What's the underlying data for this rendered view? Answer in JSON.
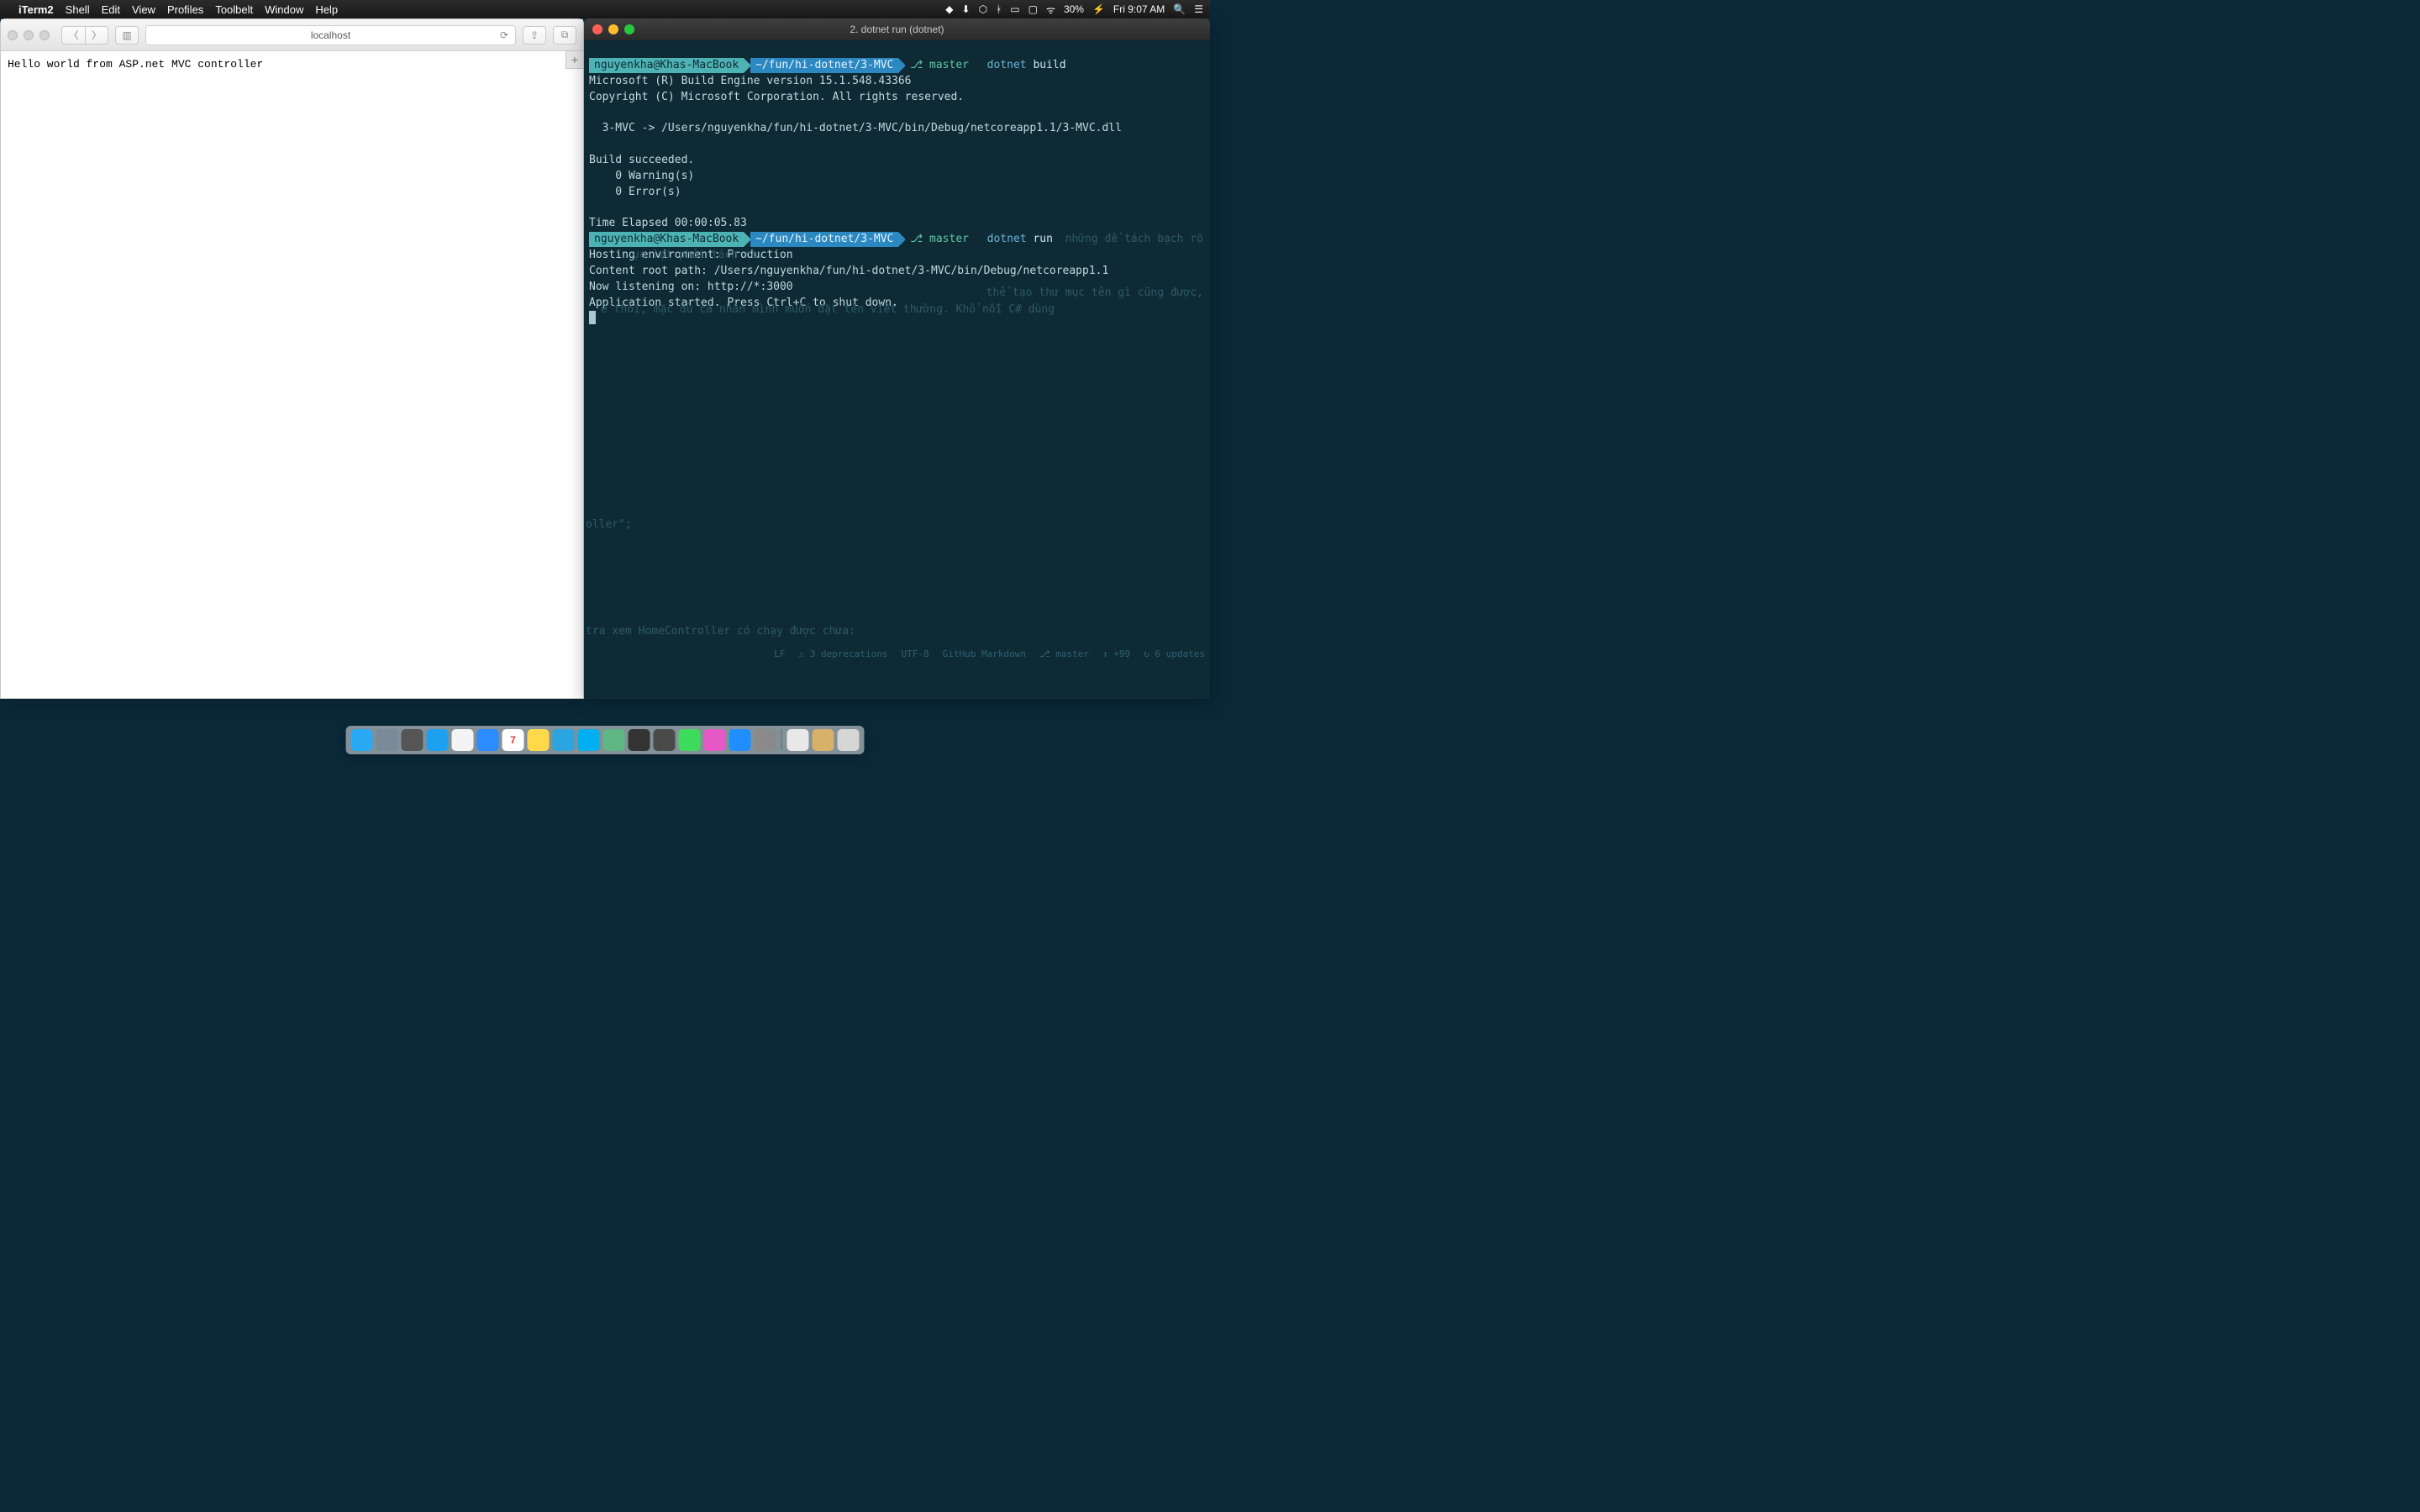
{
  "menubar": {
    "app": "iTerm2",
    "items": [
      "Shell",
      "Edit",
      "View",
      "Profiles",
      "Toolbelt",
      "Window",
      "Help"
    ],
    "battery": "30%",
    "clock": "Fri 9:07 AM"
  },
  "safari": {
    "address": "localhost",
    "body": "Hello world from ASP.net MVC controller"
  },
  "terminal": {
    "title": "2. dotnet run (dotnet)",
    "host": "nguyenkha@Khas-MacBook",
    "path": "~/fun/hi-dotnet/3-MVC",
    "branch": "master",
    "cmd1_kw": "dotnet",
    "cmd1_arg": "build",
    "out1_line1": "Microsoft (R) Build Engine version 15.1.548.43366",
    "out1_line2": "Copyright (C) Microsoft Corporation. All rights reserved.",
    "out1_line3": "  3-MVC -> /Users/nguyenkha/fun/hi-dotnet/3-MVC/bin/Debug/netcoreapp1.1/3-MVC.dll",
    "out1_line4": "Build succeeded.",
    "out1_line5": "    0 Warning(s)",
    "out1_line6": "    0 Error(s)",
    "out1_line7": "Time Elapsed 00:00:05.83",
    "cmd2_kw": "dotnet",
    "cmd2_arg": "run",
    "out2_line1": "Hosting environment: Production",
    "out2_line2": "Content root path: /Users/nguyenkha/fun/hi-dotnet/3-MVC/bin/Debug/netcoreapp1.1",
    "out2_line3": "Now listening on: http://*:3000",
    "out2_line4": "Application started. Press Ctrl+C to shut down.",
    "ghost1": "những để tách bạch rõ",
    "ghost2": "ục lại phải tách ra.",
    "ghost3": "thể tạo thư mục tên gì cũng được,",
    "ghost4": "ế thôi, mặc dù cá nhân mình muốn đặt tên viết thường. Khổ nỗi C# dùng",
    "ghost5": "oller\";",
    "ghost6": "tra xem HomeController có chạy được chưa:",
    "status": {
      "lf": "LF",
      "deprec": "3 deprecations",
      "enc": "UTF-8",
      "lang": "GitHub Markdown",
      "branch": "master",
      "stash": "+99",
      "updates": "6 updates"
    }
  },
  "dock": [
    {
      "name": "finder",
      "bg": "#2aa9f5"
    },
    {
      "name": "launchpad",
      "bg": "#7b8a99"
    },
    {
      "name": "rocket",
      "bg": "#555"
    },
    {
      "name": "safari",
      "bg": "#1ea0f1"
    },
    {
      "name": "chrome",
      "bg": "#f4f4f4"
    },
    {
      "name": "mail",
      "bg": "#2a8cff"
    },
    {
      "name": "calendar",
      "bg": "#fff",
      "text": "7",
      "color": "#e33"
    },
    {
      "name": "notes",
      "bg": "#ffd94a"
    },
    {
      "name": "telegram",
      "bg": "#2aa5e0"
    },
    {
      "name": "skype",
      "bg": "#00aff0"
    },
    {
      "name": "atom",
      "bg": "#5fb783"
    },
    {
      "name": "terminal",
      "bg": "#333"
    },
    {
      "name": "sublime",
      "bg": "#4a4a4a"
    },
    {
      "name": "messages",
      "bg": "#3ddc5c"
    },
    {
      "name": "itunes",
      "bg": "#e659c4"
    },
    {
      "name": "appstore",
      "bg": "#1f8fff"
    },
    {
      "name": "settings",
      "bg": "#8a8a8a"
    }
  ],
  "dock_right": [
    {
      "name": "document",
      "bg": "#e8e8e8"
    },
    {
      "name": "folder",
      "bg": "#d7b06a"
    },
    {
      "name": "trash",
      "bg": "#d6d6d6"
    }
  ]
}
